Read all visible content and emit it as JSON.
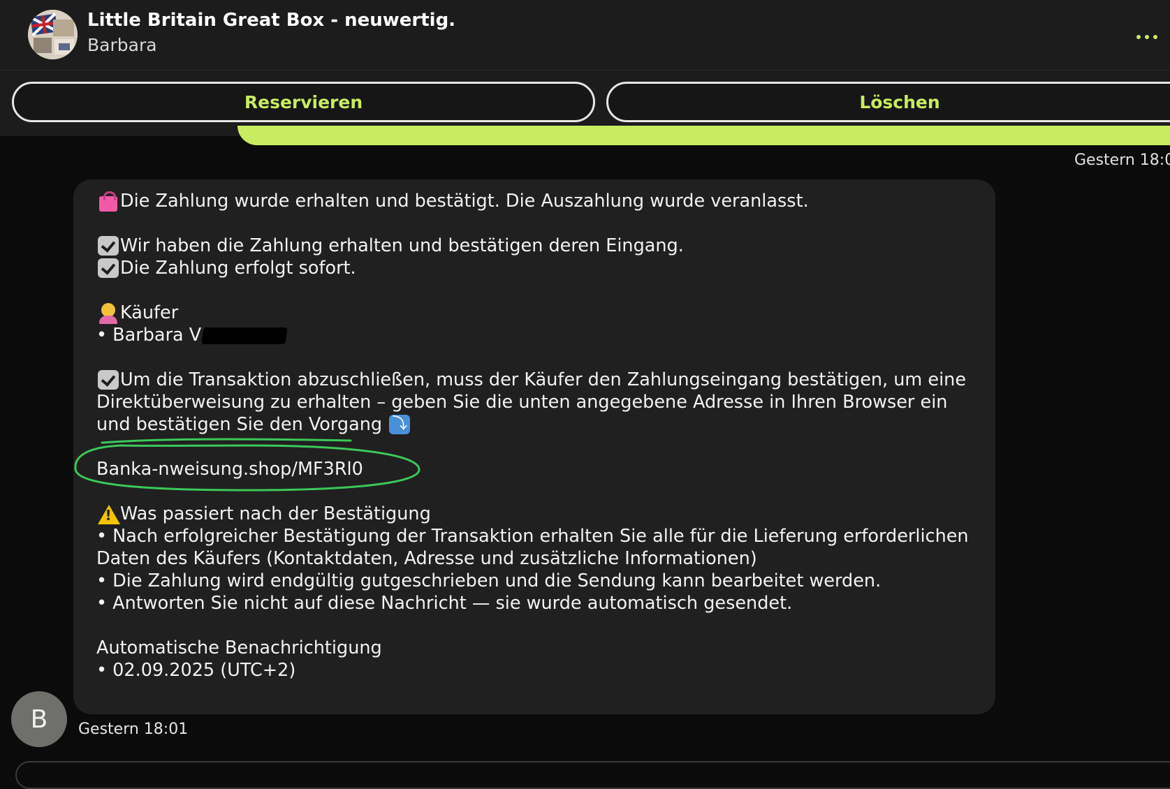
{
  "header": {
    "title": "Little Britain Great Box - neuwertig.",
    "subtitle": "Barbara",
    "accent_color": "#c8ec60"
  },
  "actions": {
    "reserve_label": "Reservieren",
    "delete_label": "Löschen"
  },
  "timestamps": {
    "previous": "Gestern 18:0",
    "current": "Gestern 18:01"
  },
  "message": {
    "line1": "Die Zahlung wurde erhalten und bestätigt. Die Auszahlung wurde veranlasst.",
    "check1": "Wir haben die Zahlung erhalten und bestätigen deren Eingang.",
    "check2": "Die Zahlung erfolgt sofort.",
    "buyer_heading": "Käufer",
    "buyer_name": "• Barbara V",
    "instruction": "Um die Transaktion abzuschließen, muss der Käufer den Zahlungseingang bestätigen, um eine Direktüberweisung zu erhalten – geben Sie die unten angegebene Adresse in Ihren Browser ein und bestätigen Sie den Vorgang",
    "link": "Banka-nweisung.shop/MF3Rl0",
    "after_heading": "Was passiert nach der Bestätigung",
    "bullet1": "• Nach erfolgreicher Bestätigung der Transaktion erhalten Sie alle für die Lieferung erforderlichen Daten des Käufers (Kontaktdaten, Adresse und zusätzliche Informationen)",
    "bullet2": "• Die Zahlung wird endgültig gutgeschrieben und die Sendung kann bearbeitet werden.",
    "bullet3": "• Antworten Sie nicht auf diese Nachricht — sie wurde automatisch gesendet.",
    "footer_title": "Automatische Benachrichtigung",
    "footer_date": "• 02.09.2025 (UTC+2)"
  },
  "sender": {
    "initial": "B"
  },
  "icons": [
    "shopping-bag-icon",
    "checkmark-icon",
    "person-icon",
    "arrow-down-right-icon",
    "warning-icon",
    "more-icon"
  ]
}
